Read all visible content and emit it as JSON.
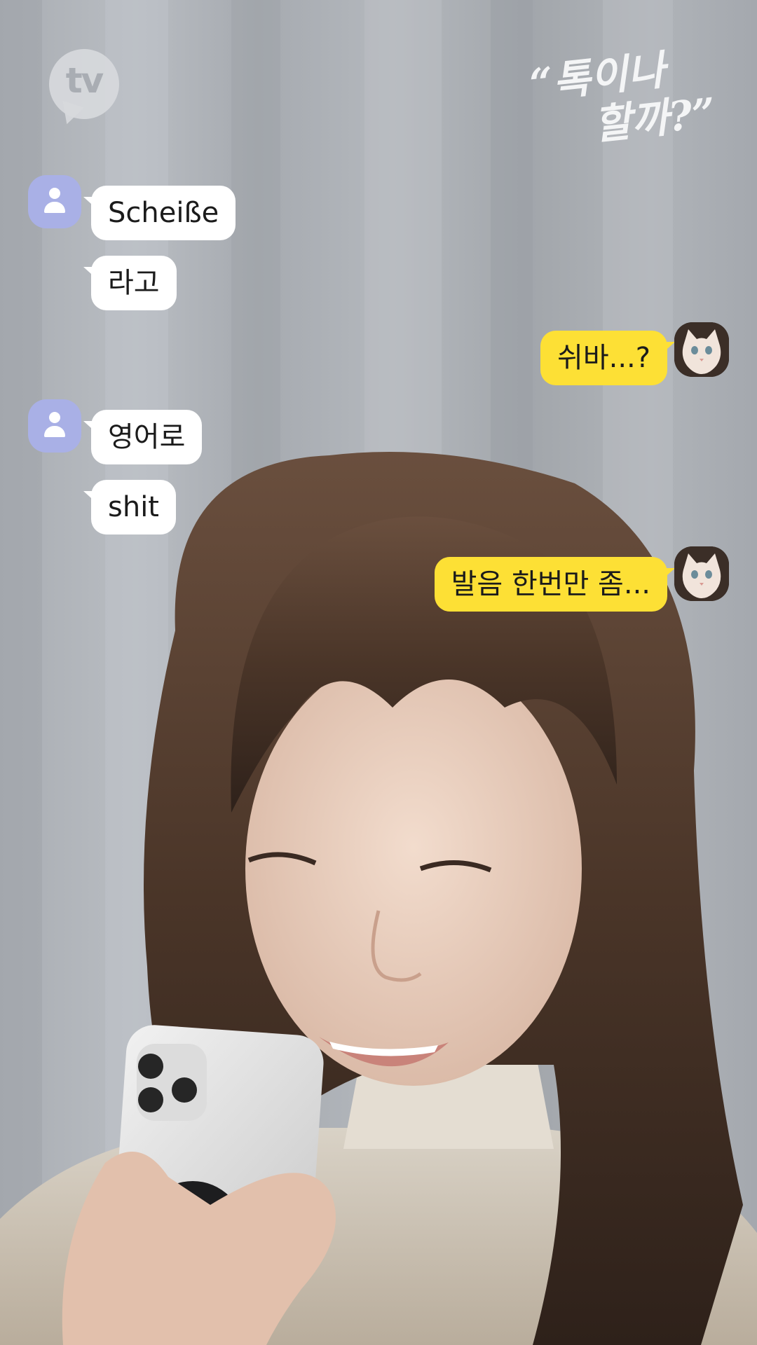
{
  "logo": {
    "text": "tv"
  },
  "title": {
    "line1": "“톡이나",
    "line2": "할까?”"
  },
  "messages": [
    {
      "text": "Scheiße"
    },
    {
      "text": "라고"
    },
    {
      "text": "쉬바...?"
    },
    {
      "text": "영어로"
    },
    {
      "text": "shit"
    },
    {
      "text": "발음 한번만 좀..."
    }
  ],
  "colors": {
    "my_bubble": "#fde035",
    "other_bubble": "#ffffff",
    "default_avatar": "#a9b0e6"
  },
  "icons": {
    "friend_avatar": "person-icon",
    "my_avatar": "cat-photo"
  }
}
